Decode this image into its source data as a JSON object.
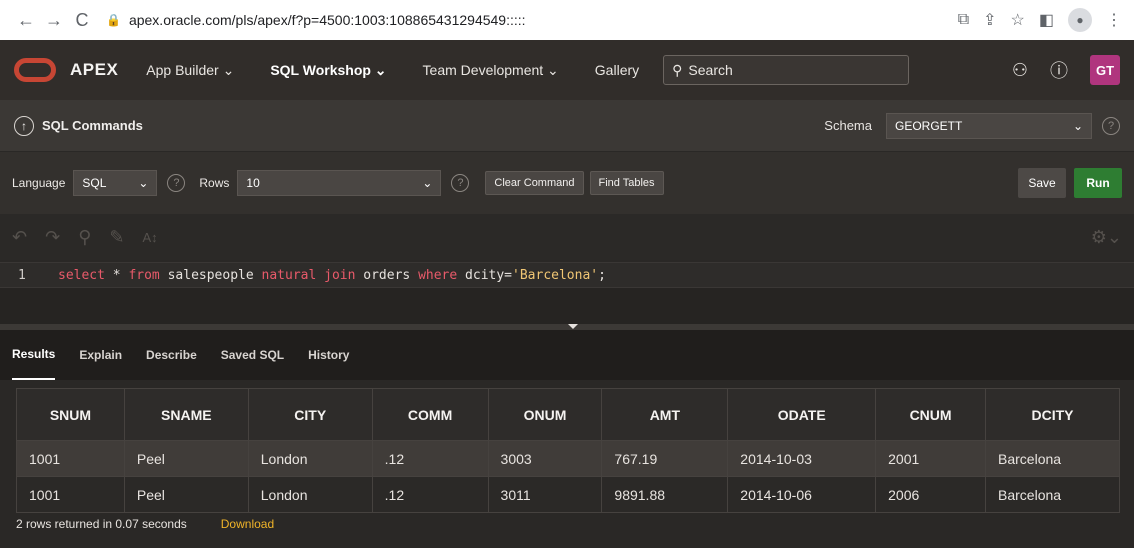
{
  "browser": {
    "url": "apex.oracle.com/pls/apex/f?p=4500:1003:108865431294549:::::",
    "back": "←",
    "forward": "→",
    "reload": "C"
  },
  "header": {
    "logo": "APEX",
    "menu": [
      {
        "label": "App Builder",
        "active": false
      },
      {
        "label": "SQL Workshop",
        "active": true
      },
      {
        "label": "Team Development",
        "active": false
      },
      {
        "label": "Gallery",
        "active": false
      }
    ],
    "search_placeholder": "Search",
    "avatar": "GT"
  },
  "sql": {
    "title": "SQL Commands",
    "schema_label": "Schema",
    "schema_value": "GEORGETT"
  },
  "toolbar": {
    "language_label": "Language",
    "language_value": "SQL",
    "rows_label": "Rows",
    "rows_value": "10",
    "clear_label": "Clear Command",
    "find_label": "Find Tables",
    "save_label": "Save",
    "run_label": "Run"
  },
  "editor": {
    "line_number": "1",
    "tokens": {
      "t1": "select",
      "t2": " * ",
      "t3": "from",
      "t4": " salespeople ",
      "t5": "natural",
      "t6": " ",
      "t7": "join",
      "t8": " orders ",
      "t9": "where",
      "t10": " dcity=",
      "t11": "'Barcelona'",
      "t12": ";"
    }
  },
  "result_tabs": [
    "Results",
    "Explain",
    "Describe",
    "Saved SQL",
    "History"
  ],
  "table": {
    "columns": [
      "SNUM",
      "SNAME",
      "CITY",
      "COMM",
      "ONUM",
      "AMT",
      "ODATE",
      "CNUM",
      "DCITY"
    ],
    "rows": [
      [
        "1001",
        "Peel",
        "London",
        ".12",
        "3003",
        "767.19",
        "2014-10-03",
        "2001",
        "Barcelona"
      ],
      [
        "1001",
        "Peel",
        "London",
        ".12",
        "3011",
        "9891.88",
        "2014-10-06",
        "2006",
        "Barcelona"
      ]
    ]
  },
  "footer": {
    "status": "2 rows returned in 0.07 seconds",
    "download": "Download"
  }
}
